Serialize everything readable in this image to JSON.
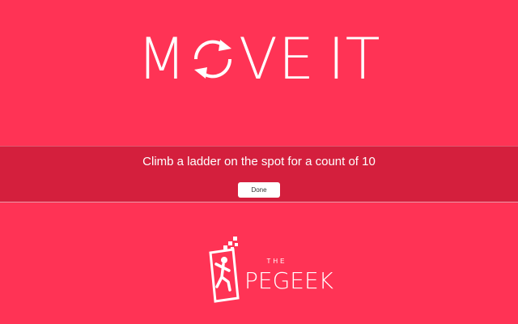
{
  "logo": {
    "part1": "M",
    "part2": "VE",
    "part3": "IT",
    "o_icon": "circular-arrows-icon"
  },
  "instruction": {
    "text": "Climb a ladder on the spot for a count of 10"
  },
  "done_button": {
    "label": "Done"
  },
  "brand": {
    "the": "THE",
    "name": "PEGEEK",
    "icon": "pe-geek-runner-icon"
  },
  "colors": {
    "background": "#ff3355",
    "band": "#d41f3d",
    "text": "#ffffff"
  }
}
